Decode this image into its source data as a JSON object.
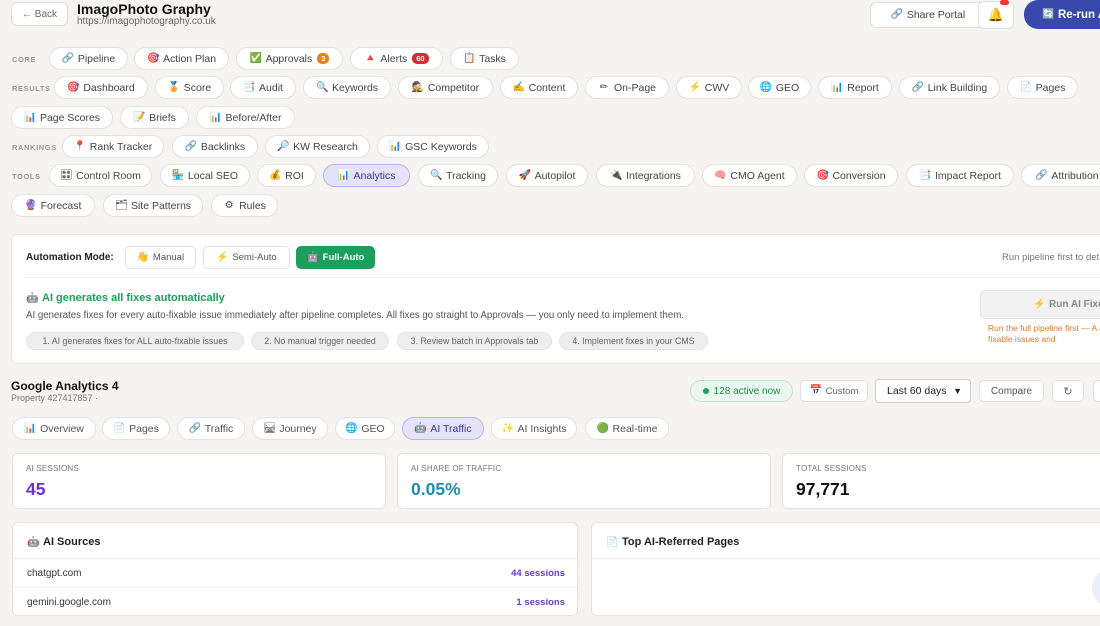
{
  "header": {
    "back_label": "← Back",
    "site_name": "ImagoPhoto Graphy",
    "site_url": "https://imagophotography.co.uk",
    "share_label": "Share Portal",
    "rerun_label": "Re-run A"
  },
  "nav": {
    "core_label": "CORE",
    "results_label": "RESULTS",
    "rankings_label": "RANKINGS",
    "tools_label": "TOOLS",
    "core": [
      {
        "label": "Pipeline",
        "icon": "🔗"
      },
      {
        "label": "Action Plan",
        "icon": "🎯"
      },
      {
        "label": "Approvals",
        "icon": "✅",
        "badge": "3"
      },
      {
        "label": "Alerts",
        "icon": "🔺",
        "badge": "60"
      },
      {
        "label": "Tasks",
        "icon": "📋"
      }
    ],
    "results": [
      {
        "label": "Dashboard",
        "icon": "🎯"
      },
      {
        "label": "Score",
        "icon": "🏅"
      },
      {
        "label": "Audit",
        "icon": "📑"
      },
      {
        "label": "Keywords",
        "icon": "🔍"
      },
      {
        "label": "Competitor",
        "icon": "🕵"
      },
      {
        "label": "Content",
        "icon": "✍"
      },
      {
        "label": "On-Page",
        "icon": "✏"
      },
      {
        "label": "CWV",
        "icon": "⚡"
      },
      {
        "label": "GEO",
        "icon": "🌐"
      },
      {
        "label": "Report",
        "icon": "📊"
      },
      {
        "label": "Link Building",
        "icon": "🔗"
      },
      {
        "label": "Pages",
        "icon": "📄"
      },
      {
        "label": "Page Scores",
        "icon": "📊"
      },
      {
        "label": "Briefs",
        "icon": "📝"
      },
      {
        "label": "Before/After",
        "icon": "📊"
      }
    ],
    "rankings": [
      {
        "label": "Rank Tracker",
        "icon": "📍"
      },
      {
        "label": "Backlinks",
        "icon": "🔗"
      },
      {
        "label": "KW Research",
        "icon": "🔎"
      },
      {
        "label": "GSC Keywords",
        "icon": "📊"
      }
    ],
    "tools": [
      {
        "label": "Control Room",
        "icon": "🎛"
      },
      {
        "label": "Local SEO",
        "icon": "🏪"
      },
      {
        "label": "ROI",
        "icon": "💰"
      },
      {
        "label": "Analytics",
        "icon": "📊"
      },
      {
        "label": "Tracking",
        "icon": "🔍"
      },
      {
        "label": "Autopilot",
        "icon": "🚀"
      },
      {
        "label": "Integrations",
        "icon": "🔌"
      },
      {
        "label": "CMO Agent",
        "icon": "🧠"
      },
      {
        "label": "Conversion",
        "icon": "🎯"
      },
      {
        "label": "Impact Report",
        "icon": "📑"
      },
      {
        "label": "Attribution",
        "icon": "🔗"
      },
      {
        "label": "Forecast",
        "icon": "🔮"
      },
      {
        "label": "Site Patterns",
        "icon": "🗂"
      },
      {
        "label": "Rules",
        "icon": "⚙"
      }
    ]
  },
  "automation": {
    "mode_label": "Automation Mode:",
    "modes": [
      {
        "label": "Manual",
        "icon": "👋"
      },
      {
        "label": "Semi-Auto",
        "icon": "⚡"
      },
      {
        "label": "Full-Auto",
        "icon": "🤖"
      }
    ],
    "hint": "Run pipeline first to det",
    "ai_heading": "AI generates all fixes automatically",
    "ai_description": "AI generates fixes for every auto-fixable issue immediately after pipeline completes. All fixes go straight to Approvals — you only need to implement them.",
    "steps": [
      "1. AI generates fixes for ALL auto-fixable issues",
      "2. No manual trigger needed",
      "3. Review batch in Approvals tab",
      "4. Implement fixes in your CMS"
    ],
    "run_button": "Run AI Fixe",
    "run_note": "Run the full pipeline first — A auto-fixable issues and"
  },
  "analytics": {
    "title": "Google Analytics 4",
    "property": "Property 427417857 ·",
    "active_now": "128 active now",
    "custom_label": "Custom",
    "date_range": "Last 60 days",
    "compare_label": "Compare",
    "tabs": [
      {
        "label": "Overview",
        "icon": "📊"
      },
      {
        "label": "Pages",
        "icon": "📄"
      },
      {
        "label": "Traffic",
        "icon": "🔗"
      },
      {
        "label": "Journey",
        "icon": "🛤"
      },
      {
        "label": "GEO",
        "icon": "🌐"
      },
      {
        "label": "AI Traffic",
        "icon": "🤖"
      },
      {
        "label": "AI Insights",
        "icon": "✨"
      },
      {
        "label": "Real-time",
        "icon": "🟢"
      }
    ],
    "stats": [
      {
        "label": "AI SESSIONS",
        "value": "45",
        "color": "#6a2fd1"
      },
      {
        "label": "AI SHARE OF TRAFFIC",
        "value": "0.05%",
        "color": "#1f8fb0"
      },
      {
        "label": "TOTAL SESSIONS",
        "value": "97,771",
        "color": "#111111"
      }
    ],
    "ai_sources": {
      "title": "AI Sources",
      "rows": [
        {
          "source": "chatgpt.com",
          "sessions": "44 sessions"
        },
        {
          "source": "gemini.google.com",
          "sessions": "1 sessions"
        }
      ]
    },
    "top_pages": {
      "title": "Top AI-Referred Pages"
    }
  }
}
